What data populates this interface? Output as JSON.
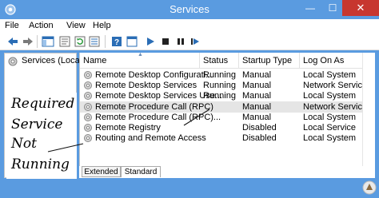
{
  "window": {
    "title": "Services",
    "controls": {
      "minimize": "—",
      "maximize": "☐",
      "close": "✕"
    }
  },
  "menu": [
    "File",
    "Action",
    "View",
    "Help"
  ],
  "toolbar": {
    "icons": [
      "back-icon",
      "forward-icon",
      "show-hide-tree-icon",
      "properties-icon",
      "refresh-icon",
      "export-list-icon",
      "help-icon",
      "console-icon",
      "start-service-icon",
      "stop-service-icon",
      "pause-service-icon",
      "restart-service-icon"
    ]
  },
  "tree": {
    "root_label": "Services (Local)"
  },
  "table": {
    "columns": [
      "Name",
      "Status",
      "Startup Type",
      "Log On As"
    ],
    "rows": [
      {
        "name": "Remote Desktop Configurati...",
        "status": "Running",
        "startup": "Manual",
        "logon": "Local System",
        "selected": false
      },
      {
        "name": "Remote Desktop Services",
        "status": "Running",
        "startup": "Manual",
        "logon": "Network Service",
        "selected": false
      },
      {
        "name": "Remote Desktop Services Use...",
        "status": "Running",
        "startup": "Manual",
        "logon": "Local System",
        "selected": false
      },
      {
        "name": "Remote Procedure Call (RPC)",
        "status": "",
        "startup": "Manual",
        "logon": "Network Service",
        "selected": true
      },
      {
        "name": "Remote Procedure Call (RPC)...",
        "status": "",
        "startup": "Manual",
        "logon": "Local System",
        "selected": false
      },
      {
        "name": "Remote Registry",
        "status": "",
        "startup": "Disabled",
        "logon": "Local Service",
        "selected": false
      },
      {
        "name": "Routing and Remote Access",
        "status": "",
        "startup": "Disabled",
        "logon": "Local System",
        "selected": false
      }
    ]
  },
  "tabs": [
    "Extended",
    "Standard"
  ],
  "active_tab": "Standard",
  "annotation": {
    "lines": [
      "Required",
      "Service",
      "Not",
      "Running"
    ]
  },
  "colors": {
    "titlebar": "#5a9be0",
    "close": "#c7372f",
    "selected_row": "#e5e5e5"
  }
}
